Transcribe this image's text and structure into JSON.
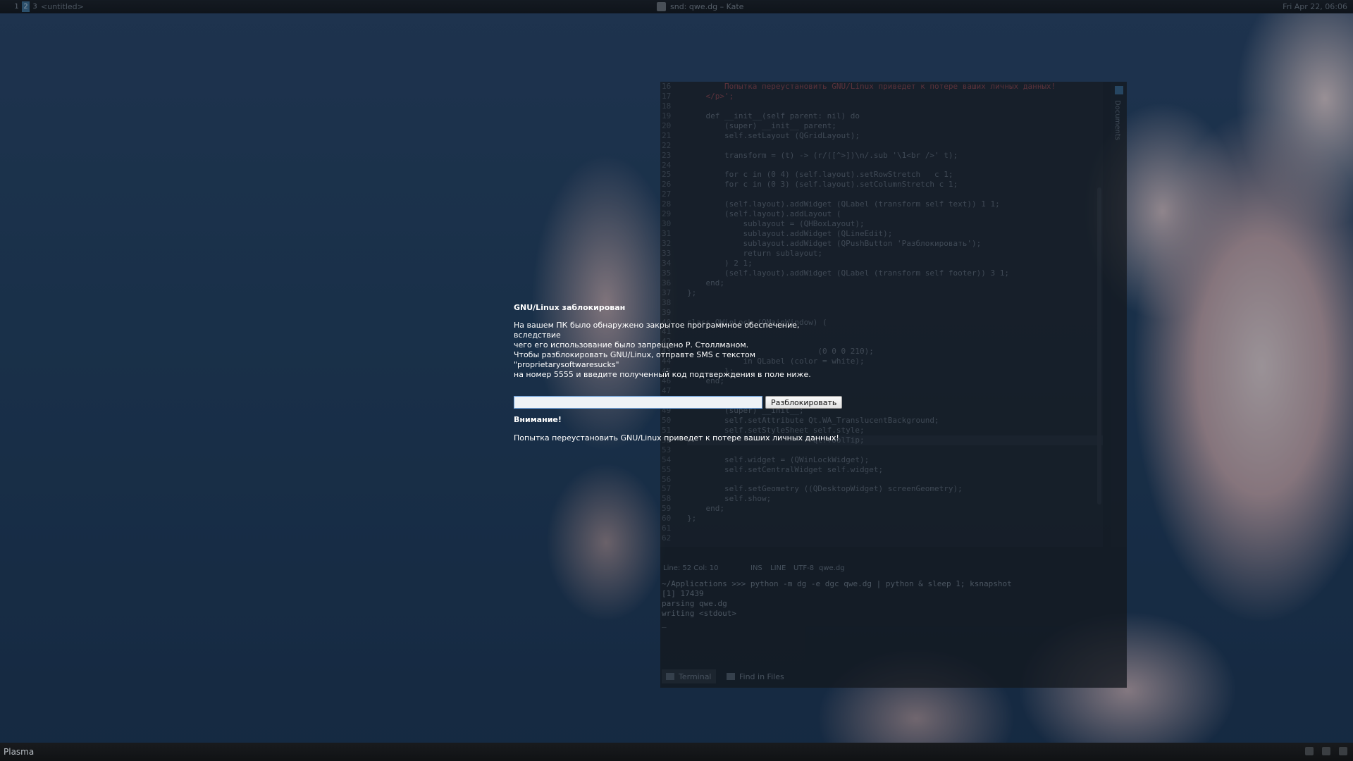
{
  "top_panel": {
    "desktops": [
      "1",
      "2",
      "3"
    ],
    "active_desktop": "2",
    "task": "<untitled>",
    "window_title": "snd: qwe.dg – Kate",
    "clock": "Fri Apr 22, 06:06"
  },
  "kate": {
    "line_numbers": [
      "16",
      "17",
      "18",
      "19",
      "20",
      "21",
      "22",
      "23",
      "24",
      "25",
      "26",
      "27",
      "28",
      "29",
      "30",
      "31",
      "32",
      "33",
      "34",
      "35",
      "36",
      "37",
      "38",
      "39",
      "40",
      "41",
      "42",
      "43",
      "44",
      "45",
      "46",
      "47",
      "48",
      "49",
      "50",
      "51",
      "52",
      "53",
      "54",
      "55",
      "56",
      "57",
      "58",
      "59",
      "60",
      "61",
      "62"
    ],
    "code_lines": [
      "        Попытка переустановить GNU/Linux приведет к потере ваших личных данных!",
      "    </p>';",
      "",
      "    def __init__(self parent: nil) do",
      "        (super) __init__ parent;",
      "        self.setLayout (QGridLayout);",
      "",
      "        transform = (t) -> (r/([^>])\\n/.sub '\\1<br />' t);",
      "",
      "        for c in (0 4) (self.layout).setRowStretch   c 1;",
      "        for c in (0 3) (self.layout).setColumnStretch c 1;",
      "",
      "        (self.layout).addWidget (QLabel (transform self text)) 1 1;",
      "        (self.layout).addLayout (",
      "            sublayout = (QHBoxLayout);",
      "            sublayout.addWidget (QLineEdit);",
      "            sublayout.addWidget (QPushButton 'Разблокировать');",
      "            return sublayout;",
      "        ) 2 1;",
      "        (self.layout).addWidget (QLabel (transform self footer)) 3 1;",
      "    end;",
      "};",
      "",
      "",
      "class QWinLock (QMainWindow) (",
      "",
      "",
      "                            (0 0 0 210);",
      "            in QLabel (color = white);",
      "        };",
      "    end;",
      "",
      "",
      "        (super) __init__;",
      "        self.setAttribute Qt.WA_TranslucentBackground;",
      "        self.setStyleSheet self.style;",
      "                           qt.ToolTip;",
      "",
      "        self.widget = (QWinLockWidget);",
      "        self.setCentralWidget self.widget;",
      "",
      "        self.setGeometry ((QDesktopWidget) screenGeometry);",
      "        self.show;",
      "    end;",
      "};",
      "",
      ""
    ],
    "sidebar_label": "Documents",
    "status": {
      "position": "Line: 52 Col: 10",
      "mode": "INS",
      "select": "LINE",
      "encoding": "UTF-8",
      "file": "qwe.dg"
    },
    "terminal_lines": [
      "~/Applications >>> python -m dg -e dgc qwe.dg | python & sleep 1; ksnapshot",
      "[1] 17439",
      "parsing qwe.dg",
      "writing <stdout>",
      "_"
    ],
    "tabs": {
      "terminal": "Terminal",
      "find": "Find in Files"
    }
  },
  "lock_dialog": {
    "title": "GNU/Linux заблокирован",
    "message_lines": [
      "На вашем ПК было обнаружено закрытое программное обеспечение, вследствие",
      "чего его использование было запрещено Р. Столлманом.",
      "Чтобы разблокировать GNU/Linux, отправте SMS с текстом \"proprietarysoftwaresucks\"",
      "на номер 5555 и введите полученный код подтверждения в поле ниже."
    ],
    "input_value": "",
    "unlock_button": "Разблокировать",
    "warning_title": "Внимание!",
    "warning_message": "Попытка переустановить GNU/Linux приведет к потере ваших личных данных!"
  },
  "bottom_panel": {
    "label": "Plasma"
  }
}
